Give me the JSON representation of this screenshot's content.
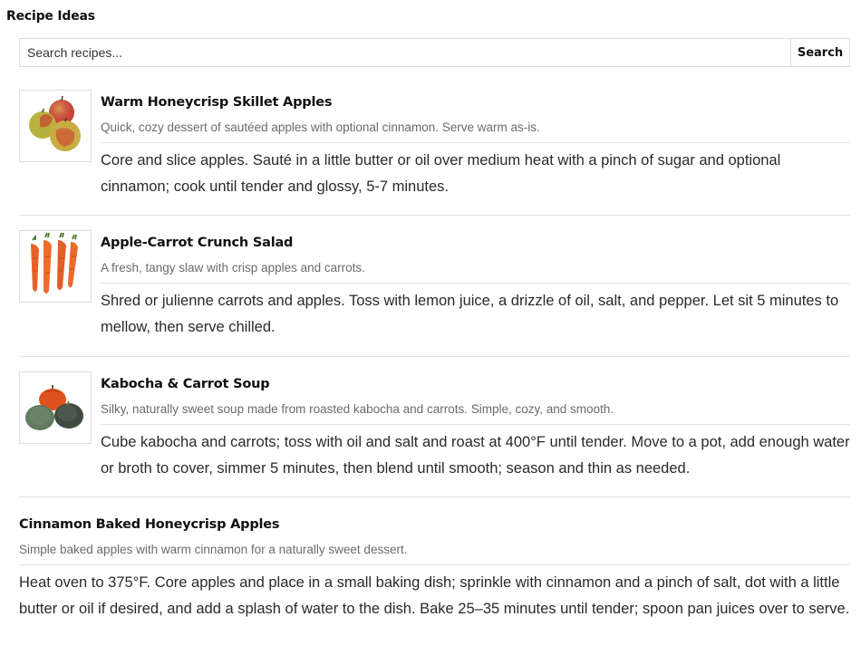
{
  "page": {
    "title": "Recipe Ideas"
  },
  "search": {
    "placeholder": "Search recipes...",
    "button_label": "Search"
  },
  "recipes": [
    {
      "title": "Warm Honeycrisp Skillet Apples",
      "description": "Quick, cozy dessert of sautéed apples with optional cinnamon. Serve warm as-is.",
      "steps": "Core and slice apples. Sauté in a little butter or oil over medium heat with a pinch of sugar and optional cinnamon; cook until tender and glossy, 5-7 minutes.",
      "image_icon": "apples-image"
    },
    {
      "title": "Apple-Carrot Crunch Salad",
      "description": "A fresh, tangy slaw with crisp apples and carrots.",
      "steps": "Shred or julienne carrots and apples. Toss with lemon juice, a drizzle of oil, salt, and pepper. Let sit 5 minutes to mellow, then serve chilled.",
      "image_icon": "carrots-image"
    },
    {
      "title": "Kabocha & Carrot Soup",
      "description": "Silky, naturally sweet soup made from roasted kabocha and carrots. Simple, cozy, and smooth.",
      "steps": "Cube kabocha and carrots; toss with oil and salt and roast at 400°F until tender. Move to a pot, add enough water or broth to cover, simmer 5 minutes, then blend until smooth; season and thin as needed.",
      "image_icon": "kabocha-squash-image"
    },
    {
      "title": "Cinnamon Baked Honeycrisp Apples",
      "description": "Simple baked apples with warm cinnamon for a naturally sweet dessert.",
      "steps": "Heat oven to 375°F. Core apples and place in a small baking dish; sprinkle with cinnamon and a pinch of salt, dot with a little butter or oil if desired, and add a splash of water to the dish. Bake 25–35 minutes until tender; spoon pan juices over to serve."
    }
  ],
  "colors": {
    "border": "#dcdcdc",
    "divider": "#e2e2e2",
    "title_text": "#111111",
    "description_text": "#6b6b6b",
    "body_text": "#2a2a2a"
  }
}
